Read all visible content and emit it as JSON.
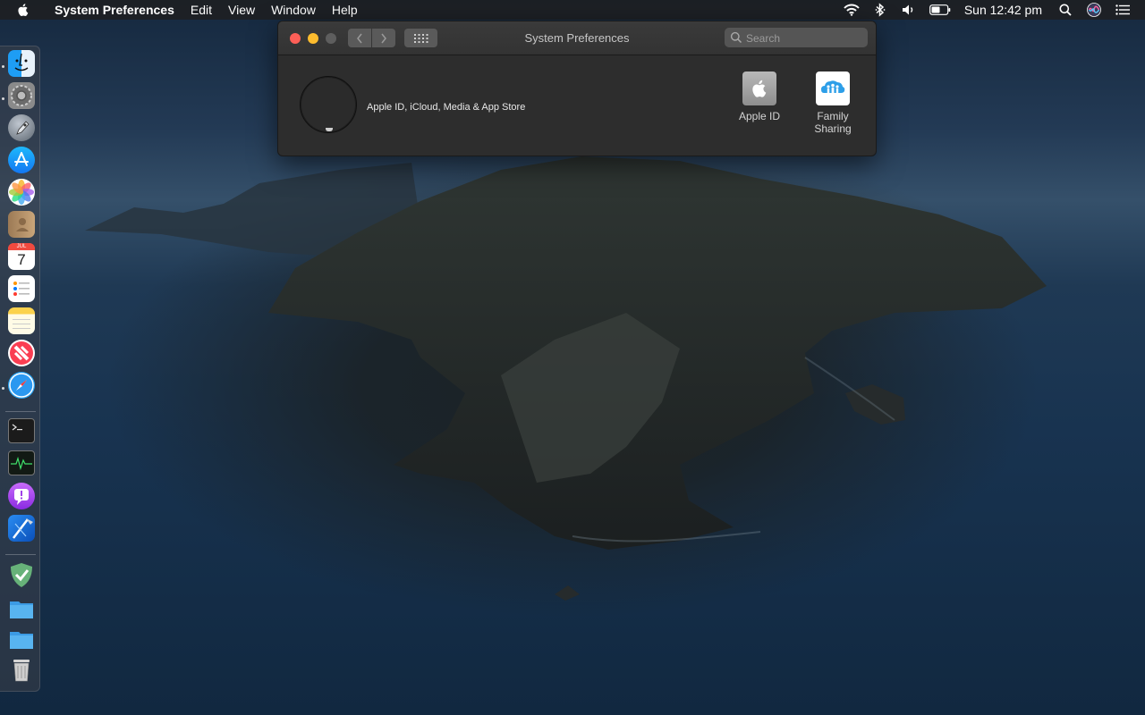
{
  "menubar": {
    "app_name": "System Preferences",
    "items": [
      "Edit",
      "View",
      "Window",
      "Help"
    ],
    "clock": "Sun 12:42 pm",
    "status_icons": [
      "wifi-icon",
      "bluetooth-icon",
      "volume-icon",
      "battery-icon",
      "spotlight-icon",
      "siri-icon",
      "notification-center-icon"
    ]
  },
  "window": {
    "title": "System Preferences",
    "search_placeholder": "Search",
    "account_label": "Apple ID, iCloud, Media & App Store",
    "prefs": [
      {
        "label": "Apple ID",
        "icon": "apple-id-icon"
      },
      {
        "label": "Family Sharing",
        "icon": "family-sharing-icon"
      }
    ]
  },
  "dock": {
    "apps": [
      "Finder",
      "System Preferences",
      "Launchpad",
      "App Store",
      "Photos",
      "Contacts",
      "Calendar",
      "Reminders",
      "Notes",
      "News",
      "Safari",
      "Terminal",
      "Activity Monitor",
      "Feedback Assistant",
      "Xcode",
      "AdGuard",
      "Applications",
      "Downloads",
      "Trash"
    ],
    "calendar_month": "JUL",
    "calendar_day": "7"
  },
  "colors": {
    "close": "#fd5f57",
    "minimize": "#fdbc2e",
    "zoom_disabled": "#5e5e5e"
  }
}
